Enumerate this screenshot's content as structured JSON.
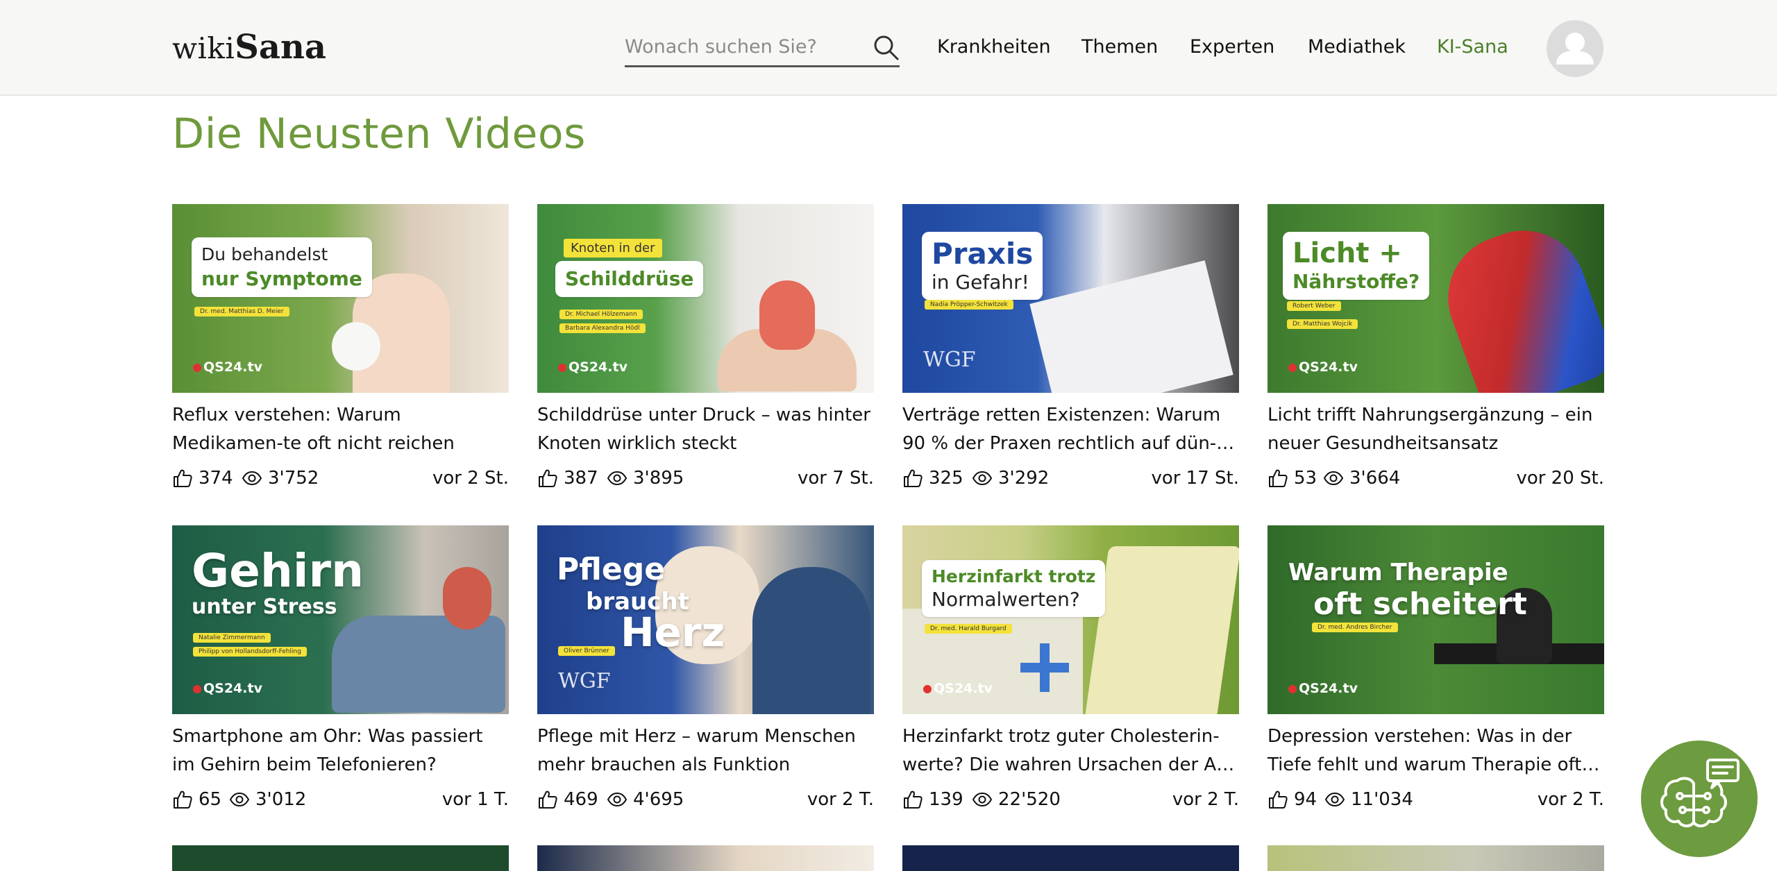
{
  "header": {
    "logo_prefix": "wiki",
    "logo_suffix": "Sana",
    "search_placeholder": "Wonach suchen Sie?",
    "nav": [
      "Krankheiten",
      "Themen",
      "Experten",
      "Mediathek",
      "KI-Sana"
    ]
  },
  "page_title": "Die Neusten Videos",
  "colors": {
    "brand_green": "#6f9a3c",
    "accent_nav": "#4c7f2a",
    "fab": "#6d9b3f"
  },
  "videos": [
    {
      "title": "Reflux verstehen: Warum Medikamen-te oft nicht reichen",
      "likes": "374",
      "views": "3'752",
      "ago": "vor 2 St.",
      "thumb": {
        "line1": "Du behandelst",
        "line2": "nur Symptome",
        "tags": [
          "Dr. med. Matthias D. Meier"
        ],
        "logo": "QS24.tv"
      }
    },
    {
      "title": "Schilddrüse unter Druck – was hinter Knoten wirklich steckt",
      "likes": "387",
      "views": "3'895",
      "ago": "vor 7 St.",
      "thumb": {
        "line1": "Knoten in der",
        "line2": "Schilddrüse",
        "tags": [
          "Dr. Michael Hölzemann",
          "Barbara Alexandra Hödl"
        ],
        "logo": "QS24.tv"
      }
    },
    {
      "title": "Verträge retten Existenzen: Warum 90 % der Praxen rechtlich auf dün-…",
      "likes": "325",
      "views": "3'292",
      "ago": "vor 17 St.",
      "thumb": {
        "line1": "Praxis",
        "line2": "in Gefahr!",
        "tags": [
          "Nadia Pröpper-Schwitzek"
        ],
        "logo": "WGF"
      }
    },
    {
      "title": "Licht trifft Nahrungsergänzung – ein neuer Gesundheitsansatz",
      "likes": "53",
      "views": "3'664",
      "ago": "vor 20 St.",
      "thumb": {
        "line1": "Licht +",
        "line2": "Nährstoffe?",
        "tags": [
          "Robert Weber",
          "Dr. Matthias Wojcik"
        ],
        "logo": "QS24.tv"
      }
    },
    {
      "title": "Smartphone am Ohr: Was passiert im Gehirn beim Telefonieren?",
      "likes": "65",
      "views": "3'012",
      "ago": "vor 1 T.",
      "thumb": {
        "line1": "Gehirn",
        "line2": "unter Stress",
        "tags": [
          "Natalie Zimmermann",
          "Philipp von Hollandsdorff-Fehling"
        ],
        "logo": "QS24.tv"
      }
    },
    {
      "title": "Pflege mit Herz – warum Menschen mehr brauchen als Funktion",
      "likes": "469",
      "views": "4'695",
      "ago": "vor 2 T.",
      "thumb": {
        "line1": "Pflege",
        "line2": "braucht",
        "line3": "Herz",
        "tags": [
          "Oliver Brünner"
        ],
        "logo": "WGF"
      }
    },
    {
      "title": "Herzinfarkt trotz guter Cholesterin-werte? Die wahren Ursachen der A…",
      "likes": "139",
      "views": "22'520",
      "ago": "vor 2 T.",
      "thumb": {
        "line1": "Herzinfarkt trotz",
        "line2": "Normalwerten?",
        "tags": [
          "Dr. med. Harald Burgard"
        ],
        "logo": "QS24.tv"
      }
    },
    {
      "title": "Depression verstehen: Was in der Tiefe fehlt und warum Therapie oft…",
      "likes": "94",
      "views": "11'034",
      "ago": "vor 2 T.",
      "thumb": {
        "line1": "Warum Therapie",
        "line2": "oft scheitert",
        "tags": [
          "Dr. med. Andres Bircher"
        ],
        "logo": "QS24.tv"
      }
    }
  ]
}
